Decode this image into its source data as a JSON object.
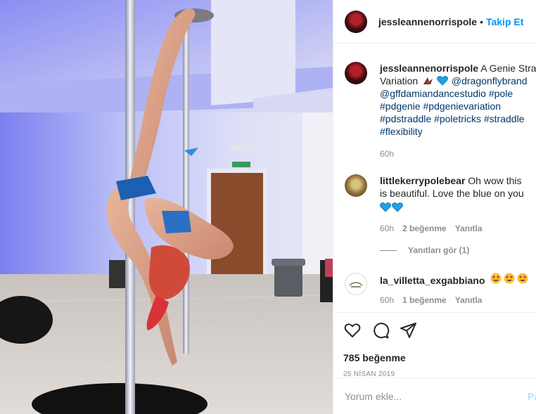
{
  "post": {
    "image_alt": "Pole dancer in a genie straddle pose",
    "owner": {
      "username": "jessleannenorrispole",
      "separator": "•",
      "follow_label": "Takip Et"
    },
    "caption": {
      "username": "jessleannenorrispole",
      "line1": "A Genie Stradd",
      "line2_pre": "Variation",
      "mention1": "@dragonflybrand",
      "mention2": "@gffdamiandancestudio",
      "tag_pole": "#pole",
      "tag_pdgenie": "#pdgenie",
      "tag_pdgenievariation": "#pdgenievariation",
      "tag_pdstraddle": "#pdstraddle",
      "tag_poletricks": "#poletricks",
      "tag_straddle": "#straddle",
      "tag_flexibility": "#flexibility",
      "time": "60h"
    },
    "comments": [
      {
        "username": "littlekerrypolebear",
        "text1": "Oh wow this",
        "text2": "is beautiful. Love the blue on you",
        "time": "60h",
        "likes": "2 beğenme",
        "reply": "Yanıtla"
      },
      {
        "username": "la_villetta_exgabbiano",
        "time": "60h",
        "likes": "1 beğenme",
        "reply": "Yanıtla"
      }
    ],
    "view_replies": "Yanıtları gör (1)",
    "like_count": "785 beğenme",
    "date": "25 NİSAN 2019",
    "add_comment_placeholder": "Yorum ekle...",
    "post_label": "Pa"
  },
  "icons": {
    "like": "heart-outline-icon",
    "comment": "speech-bubble-icon",
    "share": "paper-plane-icon"
  },
  "colors": {
    "link_blue": "#0095f6",
    "hashtag": "#00376b",
    "muted": "#8e8e8e",
    "blue_heart": "#1da1e8"
  }
}
